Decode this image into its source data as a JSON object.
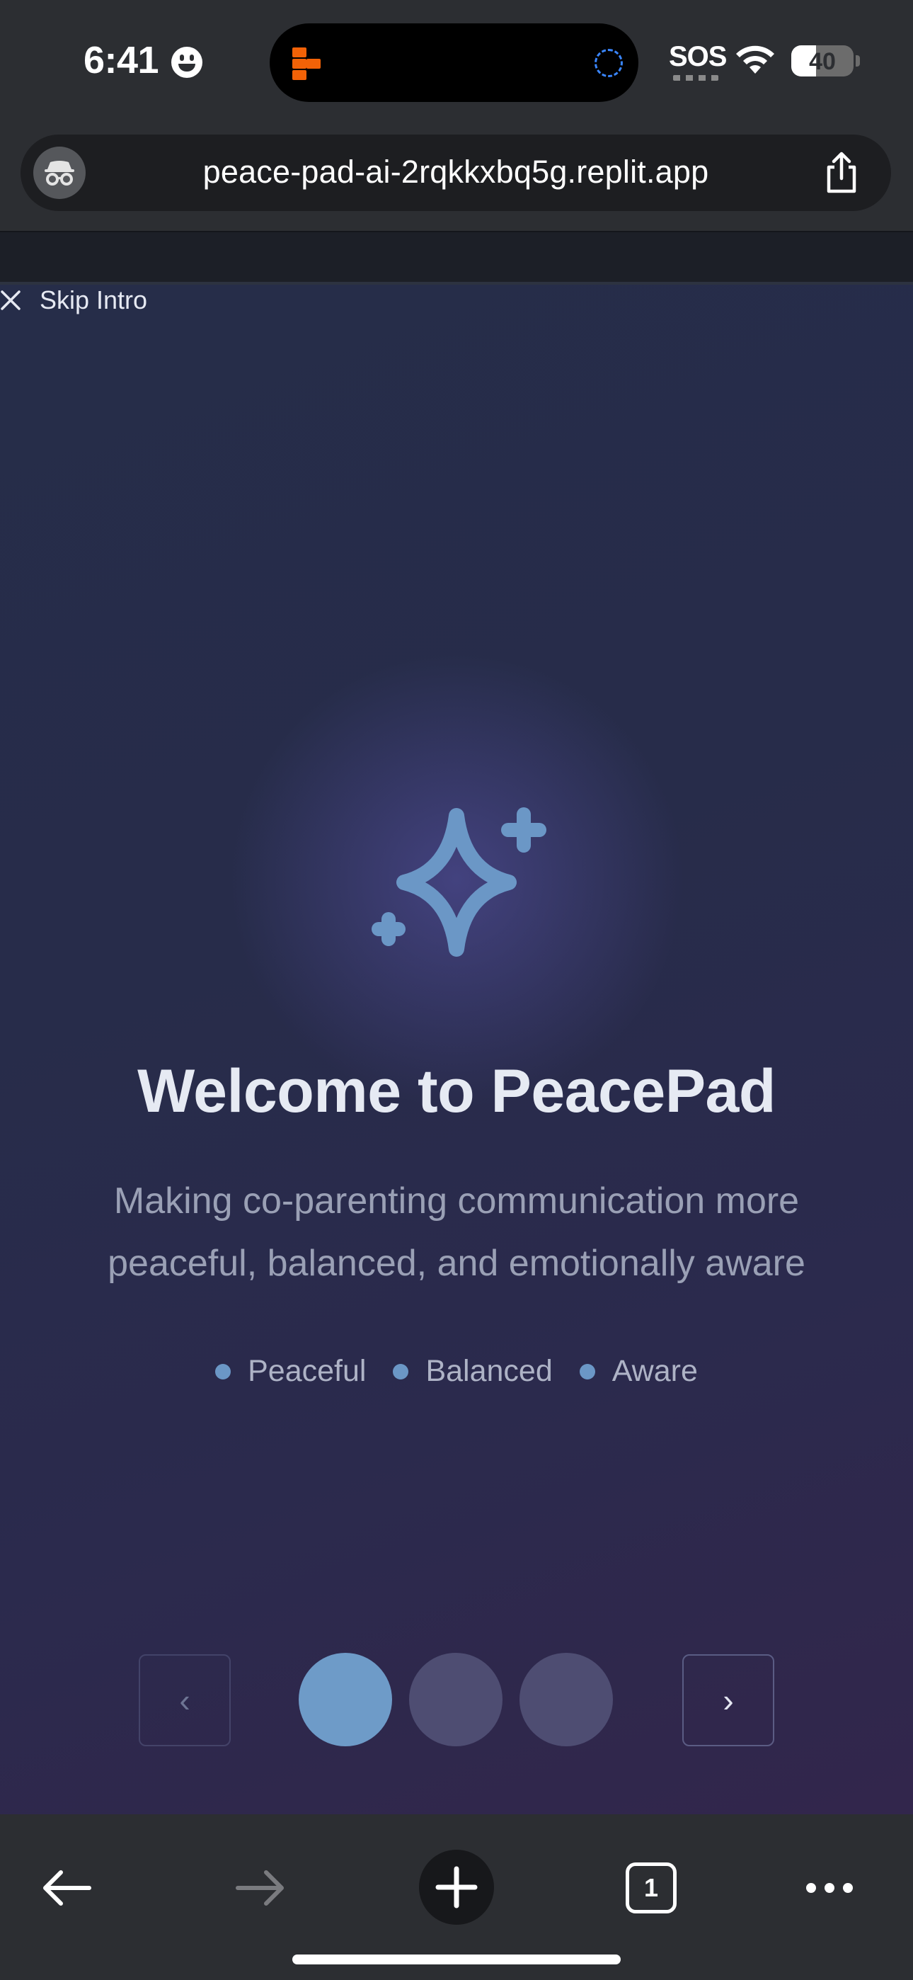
{
  "status_bar": {
    "time": "6:41",
    "sos": "SOS",
    "battery": "40",
    "battery_level": 0.4
  },
  "browser": {
    "url": "peace-pad-ai-2rqkkxbq5g.replit.app",
    "tab_count": "1"
  },
  "intro": {
    "skip_label": "Skip Intro",
    "title": "Welcome to PeacePad",
    "subtitle": "Making co-parenting communication more peaceful, balanced, and emotionally aware",
    "tags": [
      "Peaceful",
      "Balanced",
      "Aware"
    ],
    "current_step": 1,
    "total_steps": 3,
    "prev_label": "‹",
    "next_label": "›"
  },
  "colors": {
    "accent": "#6e9bc8",
    "inactive_dot": "#4e4d72",
    "background": "#272c4a"
  },
  "icons": [
    "smiley-icon",
    "incognito-icon",
    "share-icon",
    "close-icon",
    "sparkles-icon",
    "chevron-left-icon",
    "chevron-right-icon",
    "back-arrow-icon",
    "forward-arrow-icon",
    "plus-icon",
    "tabs-icon",
    "more-icon"
  ]
}
